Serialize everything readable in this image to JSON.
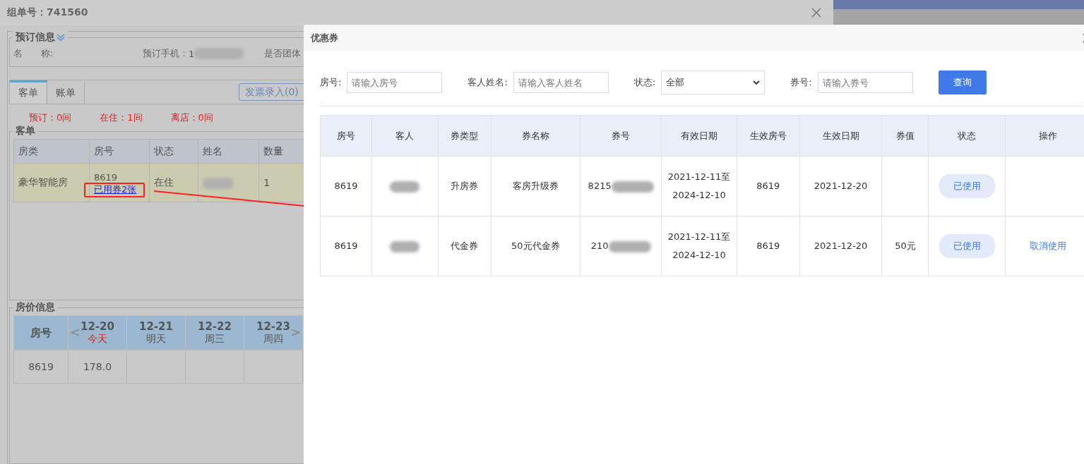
{
  "back_window": {
    "title": "组单号：741560",
    "booking": {
      "legend": "预订信息",
      "fields": [
        {
          "label": "名　　称:"
        },
        {
          "label": "预订手机：",
          "value": "1",
          "blurred": true
        },
        {
          "label": "是否团体"
        }
      ]
    },
    "tabs": [
      {
        "label": "客单",
        "selected": true
      },
      {
        "label": "账单",
        "selected": false
      }
    ],
    "invoice_button": "发票录入(0)",
    "counts": [
      "预订：0间",
      "在住：1间",
      "离店：0间"
    ],
    "guest_table": {
      "legend": "客单",
      "columns": [
        "房类",
        "房号",
        "状态",
        "姓名",
        "数量"
      ],
      "rows": [
        {
          "room_type": "豪华智能房",
          "room": "8619",
          "coupon_link": "已用券2张",
          "status": "在住",
          "name_blurred": true,
          "qty": "1"
        }
      ]
    },
    "rate_table": {
      "legend": "房价信息",
      "first_column": "房号",
      "prev": "<",
      "next": ">",
      "days": [
        {
          "date": "12-20",
          "label": "今天",
          "today": true
        },
        {
          "date": "12-21",
          "label": "明天",
          "today": false
        },
        {
          "date": "12-22",
          "label": "周三",
          "today": false
        },
        {
          "date": "12-23",
          "label": "周四",
          "today": false
        }
      ],
      "rows": [
        {
          "room": "8619",
          "prices": [
            "178.0"
          ]
        }
      ]
    }
  },
  "modal": {
    "title": "优惠券",
    "filters": [
      {
        "kind": "input",
        "label": "房号:",
        "placeholder": "请输入房号"
      },
      {
        "kind": "input",
        "label": "客人姓名:",
        "placeholder": "请输入客人姓名"
      },
      {
        "kind": "select",
        "label": "状态:",
        "value": "全部"
      },
      {
        "kind": "input",
        "label": "券号:",
        "placeholder": "请输入券号"
      }
    ],
    "search_button": "查询",
    "columns": [
      "房号",
      "客人",
      "券类型",
      "券名称",
      "券号",
      "有效日期",
      "生效房号",
      "生效日期",
      "券值",
      "状态",
      "操作"
    ],
    "rows": [
      {
        "room": "8619",
        "guest_blurred": true,
        "type": "升房券",
        "name": "客房升级券",
        "code": "8215",
        "code_blurred": true,
        "valid": [
          "2021-12-11至",
          "2024-12-10"
        ],
        "effective_room": "8619",
        "effective_date": "2021-12-20",
        "status": "已使用"
      },
      {
        "room": "8619",
        "guest_blurred": true,
        "type": "代金券",
        "name": "50元代金券",
        "code": "210",
        "code_blurred": true,
        "valid": [
          "2021-12-11至",
          "2024-12-10"
        ],
        "effective_room": "8619",
        "effective_date": "2021-12-20",
        "value": "50元",
        "status": "已使用",
        "action": "取消使用"
      }
    ]
  }
}
